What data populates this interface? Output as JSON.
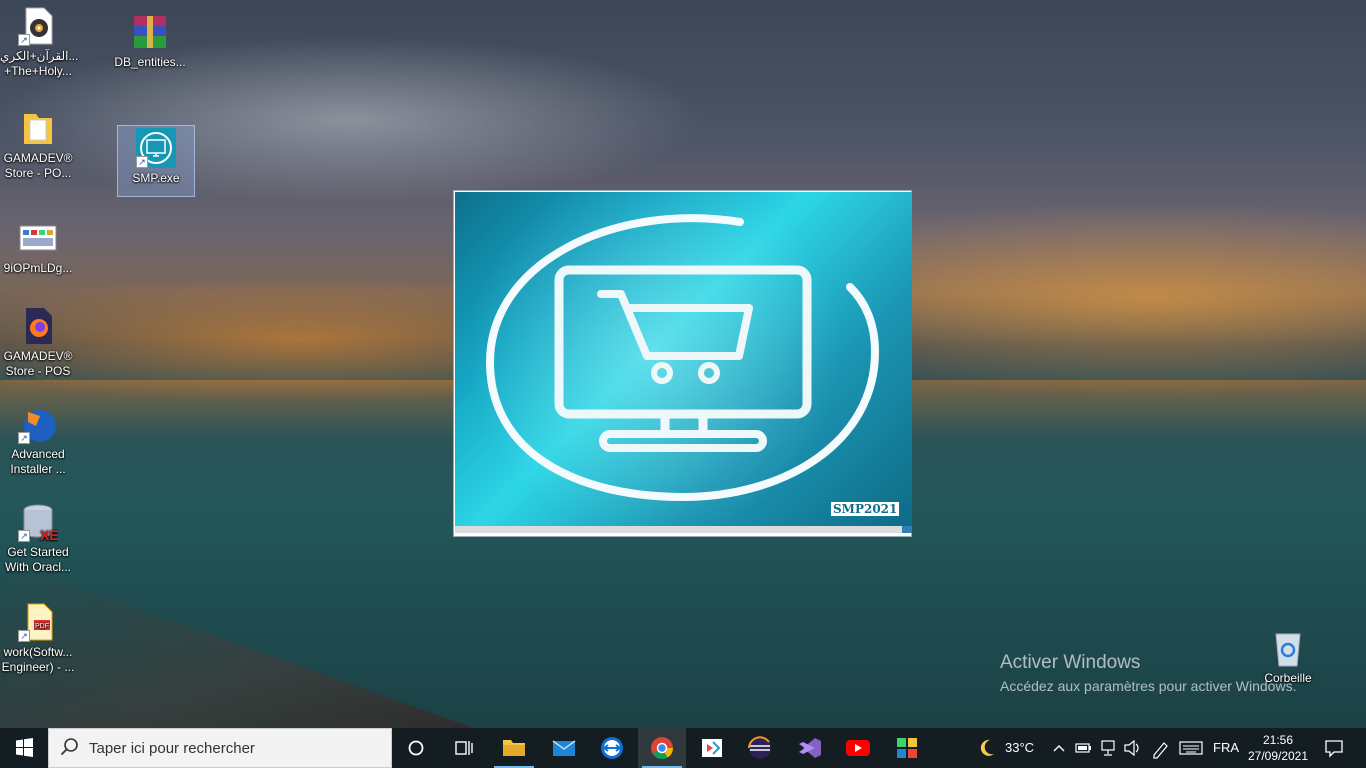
{
  "desktop": {
    "icons": [
      {
        "label1": "القرآن+الكري...",
        "label2": "+The+Holy..."
      },
      {
        "label1": "DB_entities...",
        "label2": ""
      },
      {
        "label1": "GAMADEV®",
        "label2": "Store - PO..."
      },
      {
        "label1": "SMP.exe",
        "label2": ""
      },
      {
        "label1": "9iOPmLDg...",
        "label2": ""
      },
      {
        "label1": "GAMADEV®",
        "label2": "Store - POS"
      },
      {
        "label1": "Advanced",
        "label2": "Installer ..."
      },
      {
        "label1": "Get Started",
        "label2": "With Oracl..."
      },
      {
        "label1": "work(Softw...",
        "label2": "Engineer) - ..."
      },
      {
        "label1": "Corbeille",
        "label2": ""
      }
    ]
  },
  "splash": {
    "badge": "SMP2021",
    "progress": 0.98,
    "colors": {
      "accent": "#15a6c4",
      "progress": "#2c7fb0"
    }
  },
  "watermark": {
    "title": "Activer Windows",
    "subtitle": "Accédez aux paramètres pour activer Windows."
  },
  "taskbar": {
    "search_placeholder": "Taper ici pour rechercher",
    "apps": [
      "file-explorer-icon",
      "mail-icon",
      "teamviewer-icon",
      "chrome-icon",
      "anydesk-icon",
      "eclipse-icon",
      "visual-studio-icon",
      "youtube-icon",
      "app-icon"
    ],
    "weather": "33°C",
    "language": "FRA",
    "time": "21:56",
    "date": "27/09/2021"
  }
}
